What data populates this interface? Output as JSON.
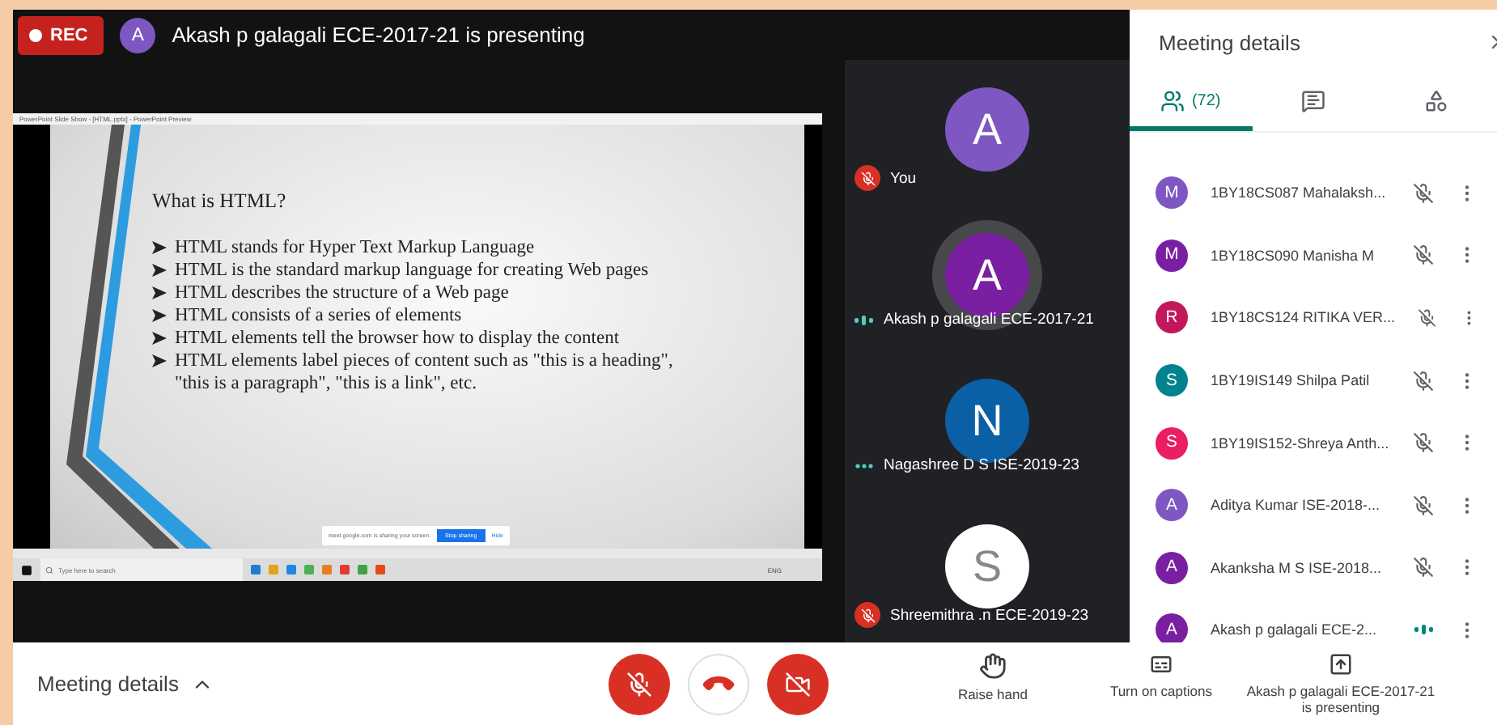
{
  "header": {
    "rec_label": "REC",
    "presenter_initial": "A",
    "presenter_text": "Akash p galagali ECE-2017-21 is presenting"
  },
  "shared_screen": {
    "window_title": "PowerPoint Slide Show - [HTML.pptx] - PowerPoint Preview",
    "slide": {
      "heading": "What is HTML?",
      "bullets": [
        "HTML stands for Hyper Text Markup Language",
        "HTML is the standard markup language for creating Web pages",
        "HTML describes the structure of a Web page",
        "HTML consists of a series of elements",
        "HTML elements tell the browser how to display the content",
        "HTML elements label pieces of content such as \"this is a heading\", \"this is a paragraph\", \"this is a link\", etc."
      ]
    },
    "sharing_bar": {
      "message": "meet.google.com is sharing your screen.",
      "stop_label": "Stop sharing",
      "hide_label": "Hide"
    },
    "taskbar": {
      "search_placeholder": "Type here to search",
      "language": "ENG"
    }
  },
  "tiles": [
    {
      "initial": "A",
      "name": "You",
      "color": "#7e57c2",
      "muted": true,
      "speaking": false
    },
    {
      "initial": "A",
      "name": "Akash p galagali ECE-2017-21",
      "color": "#7b1fa2",
      "muted": false,
      "speaking": true
    },
    {
      "initial": "N",
      "name": "Nagashree D S ISE-2019-23",
      "color": "#0b5fa5",
      "muted": false,
      "speaking": false
    },
    {
      "initial": "S",
      "name": "Shreemithra .n ECE-2019-23",
      "color": "#ffffff",
      "muted": true,
      "speaking": false
    }
  ],
  "side_panel": {
    "title": "Meeting details",
    "tabs": [
      {
        "kind": "people",
        "label": "(72)",
        "selected": true
      },
      {
        "kind": "chat",
        "selected": false
      },
      {
        "kind": "activities",
        "selected": false
      }
    ],
    "participants": [
      {
        "initial": "M",
        "name": "1BY18CS087 Mahalaksh...",
        "color": "#7e57c2",
        "muted": true
      },
      {
        "initial": "M",
        "name": "1BY18CS090 Manisha M",
        "color": "#7b1fa2",
        "muted": true
      },
      {
        "initial": "R",
        "name": "1BY18CS124 RITIKA VER...",
        "color": "#c2185b",
        "muted": true
      },
      {
        "initial": "S",
        "name": "1BY19IS149 Shilpa Patil",
        "color": "#00838f",
        "muted": true
      },
      {
        "initial": "S",
        "name": "1BY19IS152-Shreya Anth...",
        "color": "#e91e63",
        "muted": true
      },
      {
        "initial": "A",
        "name": "Aditya Kumar ISE-2018-...",
        "color": "#7e57c2",
        "muted": true
      },
      {
        "initial": "A",
        "name": "Akanksha M S ISE-2018...",
        "color": "#7b1fa2",
        "muted": true
      },
      {
        "initial": "A",
        "name": "Akash p galagali ECE-2...",
        "color": "#7b1fa2",
        "muted": false
      }
    ]
  },
  "bottom_bar": {
    "details_label": "Meeting details",
    "call_controls": [
      {
        "kind": "mic",
        "on": false
      },
      {
        "kind": "hangup"
      },
      {
        "kind": "camera",
        "on": false
      }
    ],
    "actions": [
      {
        "kind": "hand",
        "label": "Raise hand"
      },
      {
        "kind": "captions",
        "label": "Turn on captions"
      },
      {
        "kind": "present",
        "label": "Akash p galagali ECE-2017-21 is presenting"
      }
    ]
  }
}
